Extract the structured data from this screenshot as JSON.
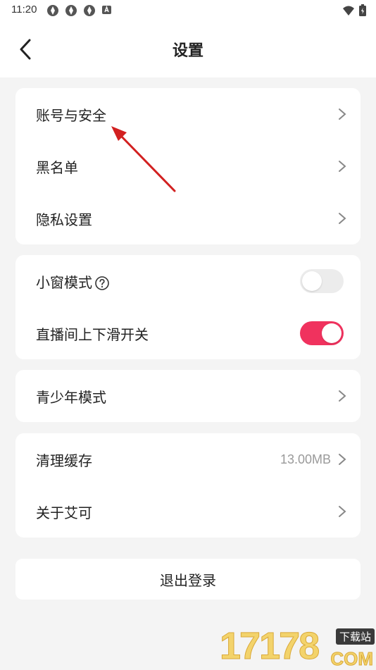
{
  "status_bar": {
    "time": "11:20"
  },
  "header": {
    "title": "设置"
  },
  "groups": {
    "account": {
      "items": [
        {
          "label": "账号与安全"
        },
        {
          "label": "黑名单"
        },
        {
          "label": "隐私设置"
        }
      ]
    },
    "toggles": {
      "items": [
        {
          "label": "小窗模式",
          "on": false
        },
        {
          "label": "直播间上下滑开关",
          "on": true
        }
      ]
    },
    "teen": {
      "label": "青少年模式"
    },
    "storage": {
      "items": [
        {
          "label": "清理缓存",
          "value": "13.00MB"
        },
        {
          "label": "关于艾可"
        }
      ]
    }
  },
  "logout": {
    "label": "退出登录"
  },
  "watermark": {
    "number": "17178",
    "tag": "下载站",
    "suffix": "COM"
  },
  "colors": {
    "accent": "#f0325e",
    "background": "#f4f4f4",
    "card": "#ffffff",
    "annotation_arrow": "#d22020"
  }
}
